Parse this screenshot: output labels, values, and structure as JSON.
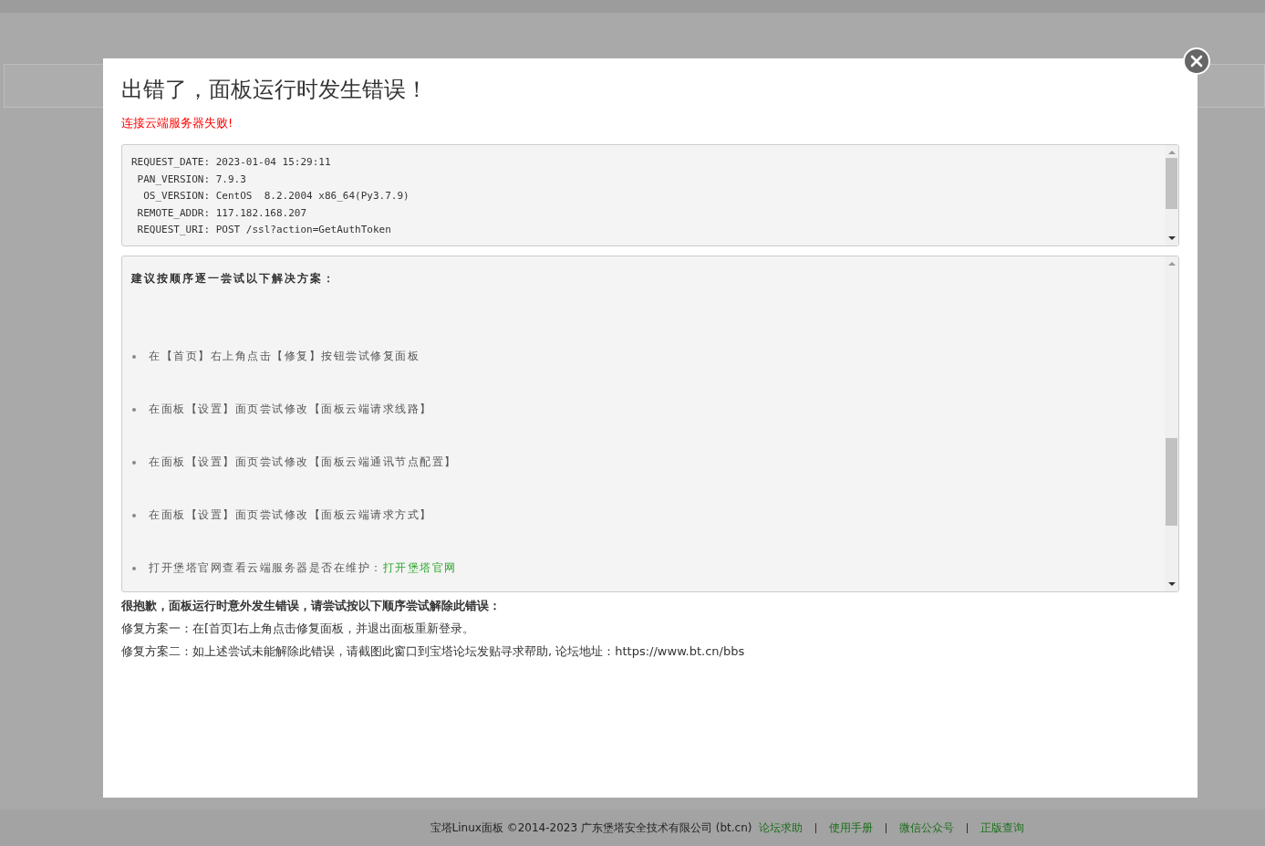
{
  "dialog": {
    "title": "出错了，面板运行时发生错误！",
    "error_message": "连接云端服务器失败!",
    "details": [
      "REQUEST_DATE: 2023-01-04 15:29:11",
      " PAN_VERSION: 7.9.3",
      "  OS_VERSION: CentOS  8.2.2004 x86_64(Py3.7.9)",
      " REMOTE_ADDR: 117.182.168.207",
      " REQUEST_URI: POST /ssl?action=GetAuthToken"
    ],
    "suggestions": {
      "heading": "建议按顺序逐一尝试以下解决方案：",
      "items": [
        {
          "text": "在【首页】右上角点击【修复】按钮尝试修复面板"
        },
        {
          "text": "在面板【设置】面页尝试修改【面板云端请求线路】"
        },
        {
          "text": "在面板【设置】面页尝试修改【面板云端通讯节点配置】"
        },
        {
          "text": "在面板【设置】面页尝试修改【面板云端请求方式】"
        },
        {
          "text": "打开堡塔官网查看云端服务器是否在维护：",
          "link": "打开堡塔官网"
        }
      ]
    },
    "apology": "很抱歉，面板运行时意外发生错误，请尝试按以下顺序尝试解除此错误：",
    "fixes": [
      "修复方案一：在[首页]右上角点击修复面板，并退出面板重新登录。",
      "修复方案二：如上述尝试未能解除此错误，请截图此窗口到宝塔论坛发贴寻求帮助, 论坛地址：https://www.bt.cn/bbs"
    ]
  },
  "footer": {
    "copyright": "宝塔Linux面板 ©2014-2023 广东堡塔安全技术有限公司 (bt.cn)",
    "links": [
      "论坛求助",
      "使用手册",
      "微信公众号",
      "正版查询"
    ]
  }
}
